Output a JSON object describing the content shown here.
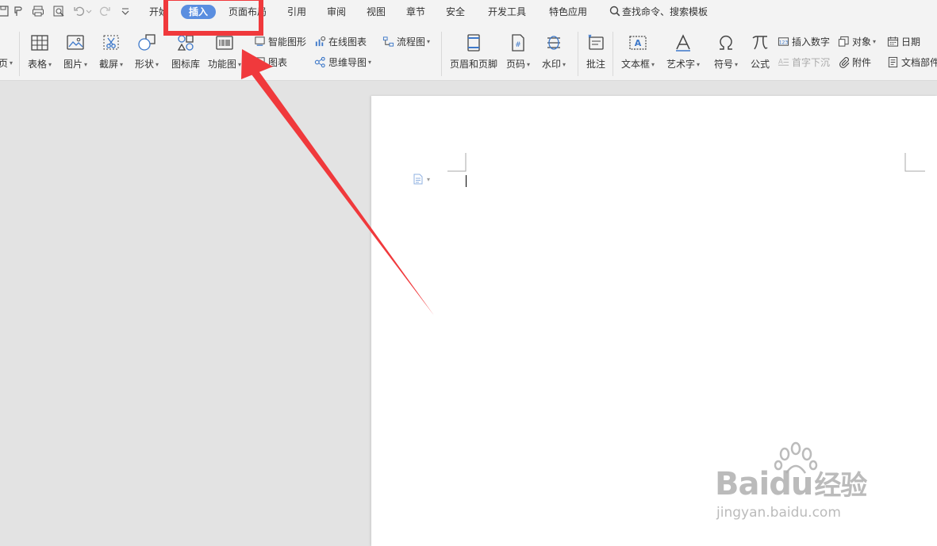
{
  "menubar": {
    "tabs": [
      {
        "label": "开始",
        "active": false
      },
      {
        "label": "插入",
        "active": true
      },
      {
        "label": "页面布局",
        "active": false
      },
      {
        "label": "引用",
        "active": false
      },
      {
        "label": "审阅",
        "active": false
      },
      {
        "label": "视图",
        "active": false
      },
      {
        "label": "章节",
        "active": false
      },
      {
        "label": "安全",
        "active": false
      },
      {
        "label": "开发工具",
        "active": false
      },
      {
        "label": "特色应用",
        "active": false
      }
    ],
    "search_label": "查找命令、搜索模板"
  },
  "ribbon": {
    "left_partial_label": "页",
    "table": "表格",
    "picture": "图片",
    "screenshot": "截屏",
    "shape": "形状",
    "icon_library": "图标库",
    "function_chart": "功能图",
    "smart_art": "智能图形",
    "chart": "图表",
    "online_chart": "在线图表",
    "mind_map": "思维导图",
    "flowchart": "流程图",
    "header_footer": "页眉和页脚",
    "page_number": "页码",
    "watermark": "水印",
    "comment": "批注",
    "textbox": "文本框",
    "art_text": "艺术字",
    "symbol": "符号",
    "formula": "公式",
    "insert_number": "插入数字",
    "drop_cap": "首字下沉",
    "object": "对象",
    "attachment": "附件",
    "date": "日期",
    "doc_parts": "文档部件"
  },
  "watermark": {
    "brand": "Bai",
    "brand2": "du",
    "suffix": "经验",
    "url": "jingyan.baidu.com"
  },
  "colors": {
    "accent_tab": "#5a8ee0",
    "annotation_red": "#f0393c",
    "icon_blue": "#3d78c9"
  }
}
